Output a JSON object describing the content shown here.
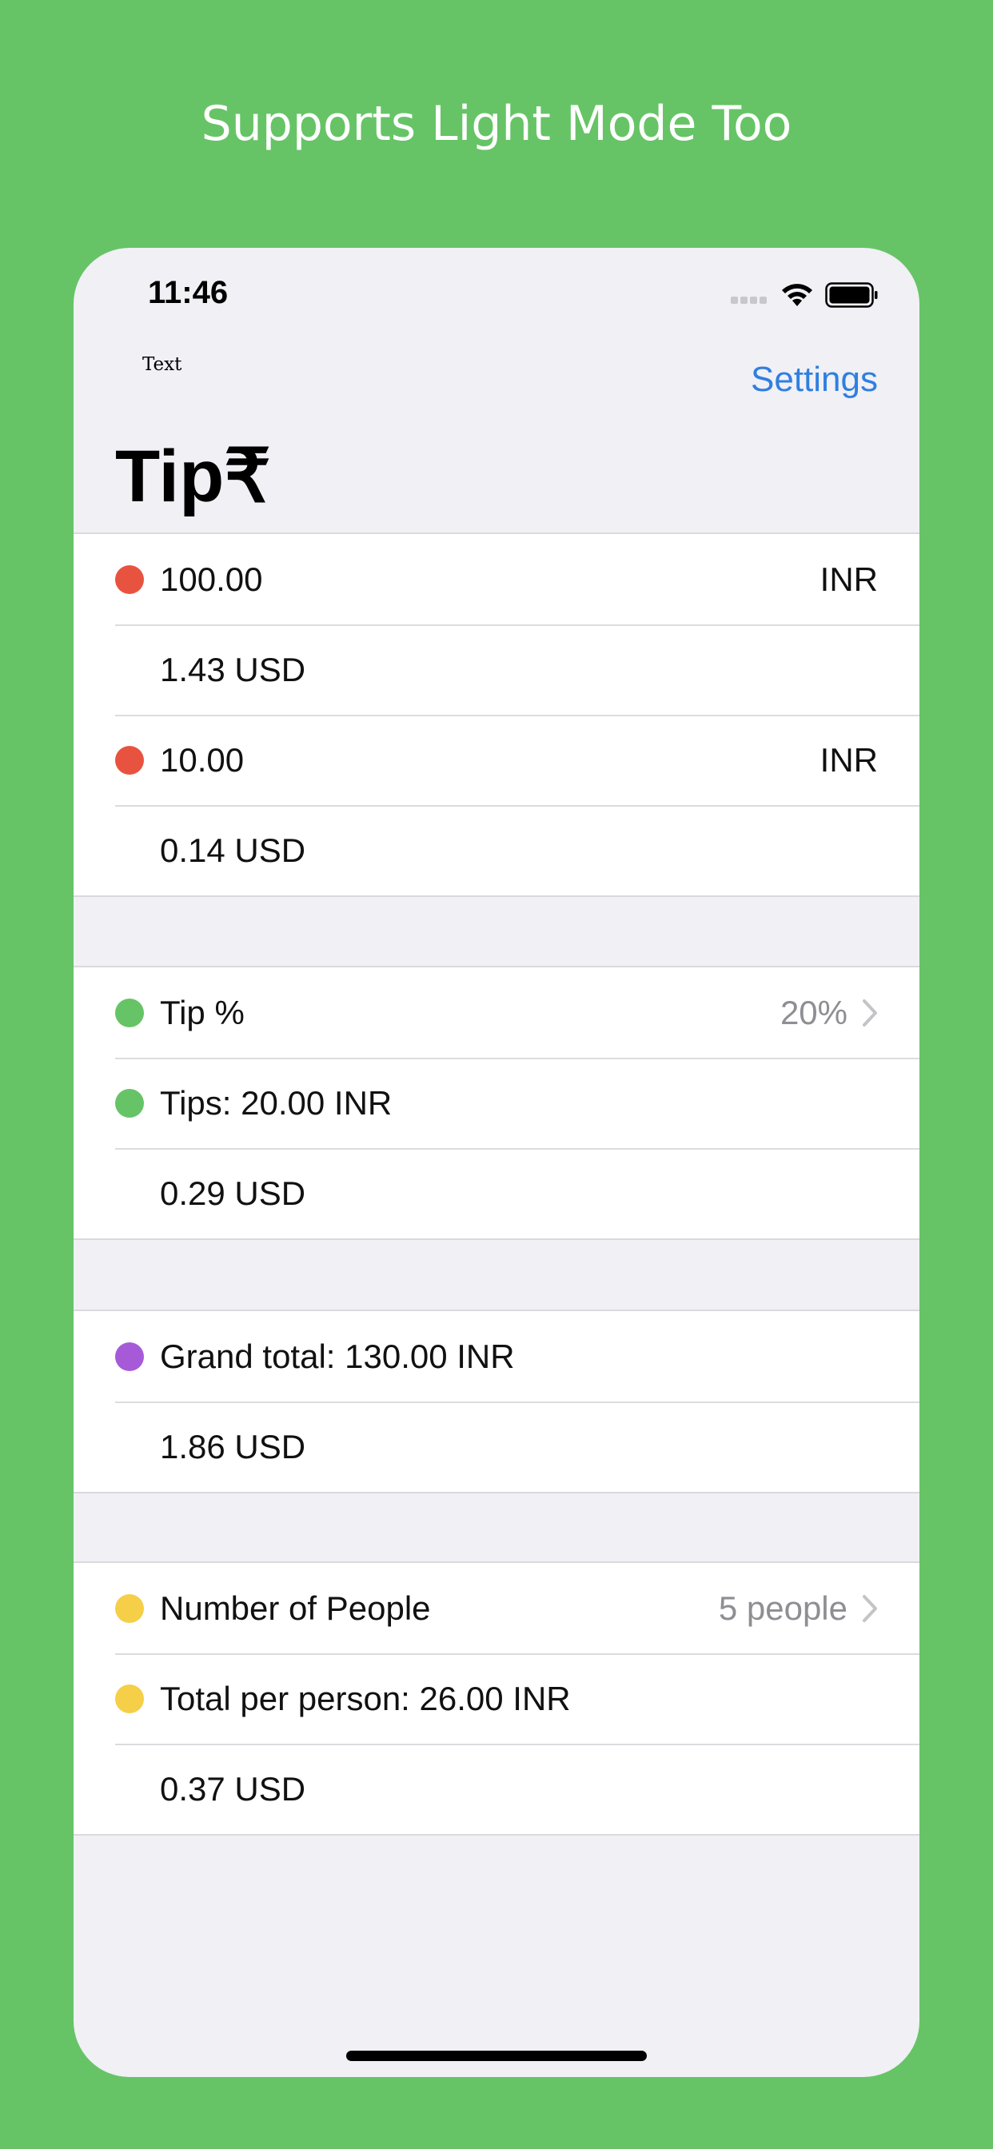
{
  "caption": "Supports Light Mode Too",
  "status_bar": {
    "time": "11:46"
  },
  "nav": {
    "text_label": "Text",
    "settings_label": "Settings",
    "title": "Tip₹"
  },
  "colors": {
    "background": "#66c466",
    "accent": "#2f7fe0",
    "red_dot": "#e8533f",
    "green_dot": "#66c466",
    "purple_dot": "#a75ad8",
    "yellow_dot": "#f5cf48"
  },
  "bill_section": {
    "rows": [
      {
        "dot": "red",
        "label": "100.00",
        "right": "INR"
      },
      {
        "label": "1.43  USD"
      },
      {
        "dot": "red",
        "label": "10.00",
        "right": "INR"
      },
      {
        "label": "0.14  USD"
      }
    ]
  },
  "tip_section": {
    "rows": [
      {
        "dot": "green",
        "label": "Tip %",
        "right": "20%",
        "has_chevron": true
      },
      {
        "dot": "green",
        "label": "Tips: 20.00  INR"
      },
      {
        "label": "0.29  USD"
      }
    ]
  },
  "total_section": {
    "rows": [
      {
        "dot": "purple",
        "label": "Grand total: 130.00  INR"
      },
      {
        "label": "1.86  USD"
      }
    ]
  },
  "people_section": {
    "rows": [
      {
        "dot": "yellow",
        "label": "Number of People",
        "right": "5 people",
        "has_chevron": true
      },
      {
        "dot": "yellow",
        "label": "Total per person: 26.00  INR"
      },
      {
        "label": "0.37  USD"
      }
    ]
  }
}
